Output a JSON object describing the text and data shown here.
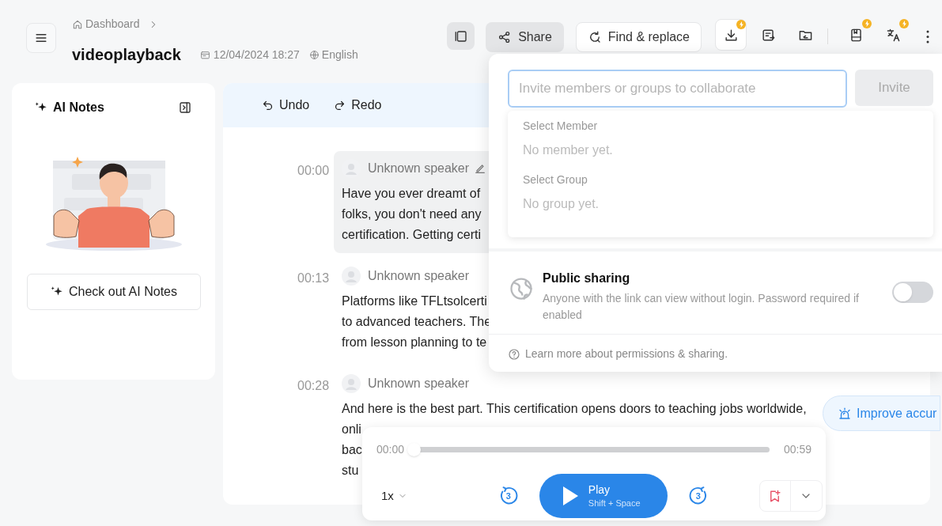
{
  "header": {
    "breadcrumb": "Dashboard",
    "title": "videoplayback",
    "date": "12/04/2024 18:27",
    "language": "English"
  },
  "toolbar": {
    "panel_toggle": {
      "active": true
    },
    "share": {
      "label": "Share",
      "active": true
    },
    "find_replace": {
      "label": "Find & replace",
      "active": false
    },
    "icon_buttons": [
      {
        "badge": true,
        "outlined": true
      },
      {
        "badge": false,
        "outlined": false
      },
      {
        "badge": false,
        "outlined": false
      },
      {
        "badge": true,
        "outlined": false
      },
      {
        "badge": true,
        "outlined": false
      }
    ]
  },
  "ai_notes": {
    "title": "AI Notes",
    "button": "Check out AI Notes"
  },
  "editor": {
    "undo": "Undo",
    "redo": "Redo"
  },
  "transcript": [
    {
      "time": "00:00",
      "speaker": "Unknown speaker",
      "selected": true,
      "lines": [
        "Have you ever dreamt of",
        "folks, you don't need any",
        "certification. Getting certi"
      ]
    },
    {
      "time": "00:13",
      "speaker": "Unknown speaker",
      "selected": false,
      "lines": [
        "Platforms like TFLtsolcerti",
        "to advanced teachers. The",
        "from lesson planning to te"
      ]
    },
    {
      "time": "00:28",
      "speaker": "Unknown speaker",
      "selected": false,
      "lines": [
        "And here is the best part. This certification opens doors to teaching jobs worldwide,",
        "onli",
        "bac",
        "stu"
      ]
    }
  ],
  "share_popover": {
    "placeholder": "Invite members or groups to collaborate",
    "invite": {
      "label": "Invite",
      "disabled": true
    },
    "dropdown": [
      {
        "heading": "Select Member",
        "empty": "No member yet."
      },
      {
        "heading": "Select Group",
        "empty": "No group yet."
      }
    ],
    "public_sharing": {
      "title": "Public sharing",
      "description": "Anyone with the link can view without login. Password required if enabled",
      "on": false
    },
    "help": "Learn more about permissions & sharing."
  },
  "improve_button": "Improve accur",
  "player": {
    "current": "00:00",
    "total": "00:59",
    "level": 0,
    "speed": "1x",
    "rewind": "3",
    "forward": "3",
    "play": "Play",
    "shortcut": "Shift + Space"
  }
}
